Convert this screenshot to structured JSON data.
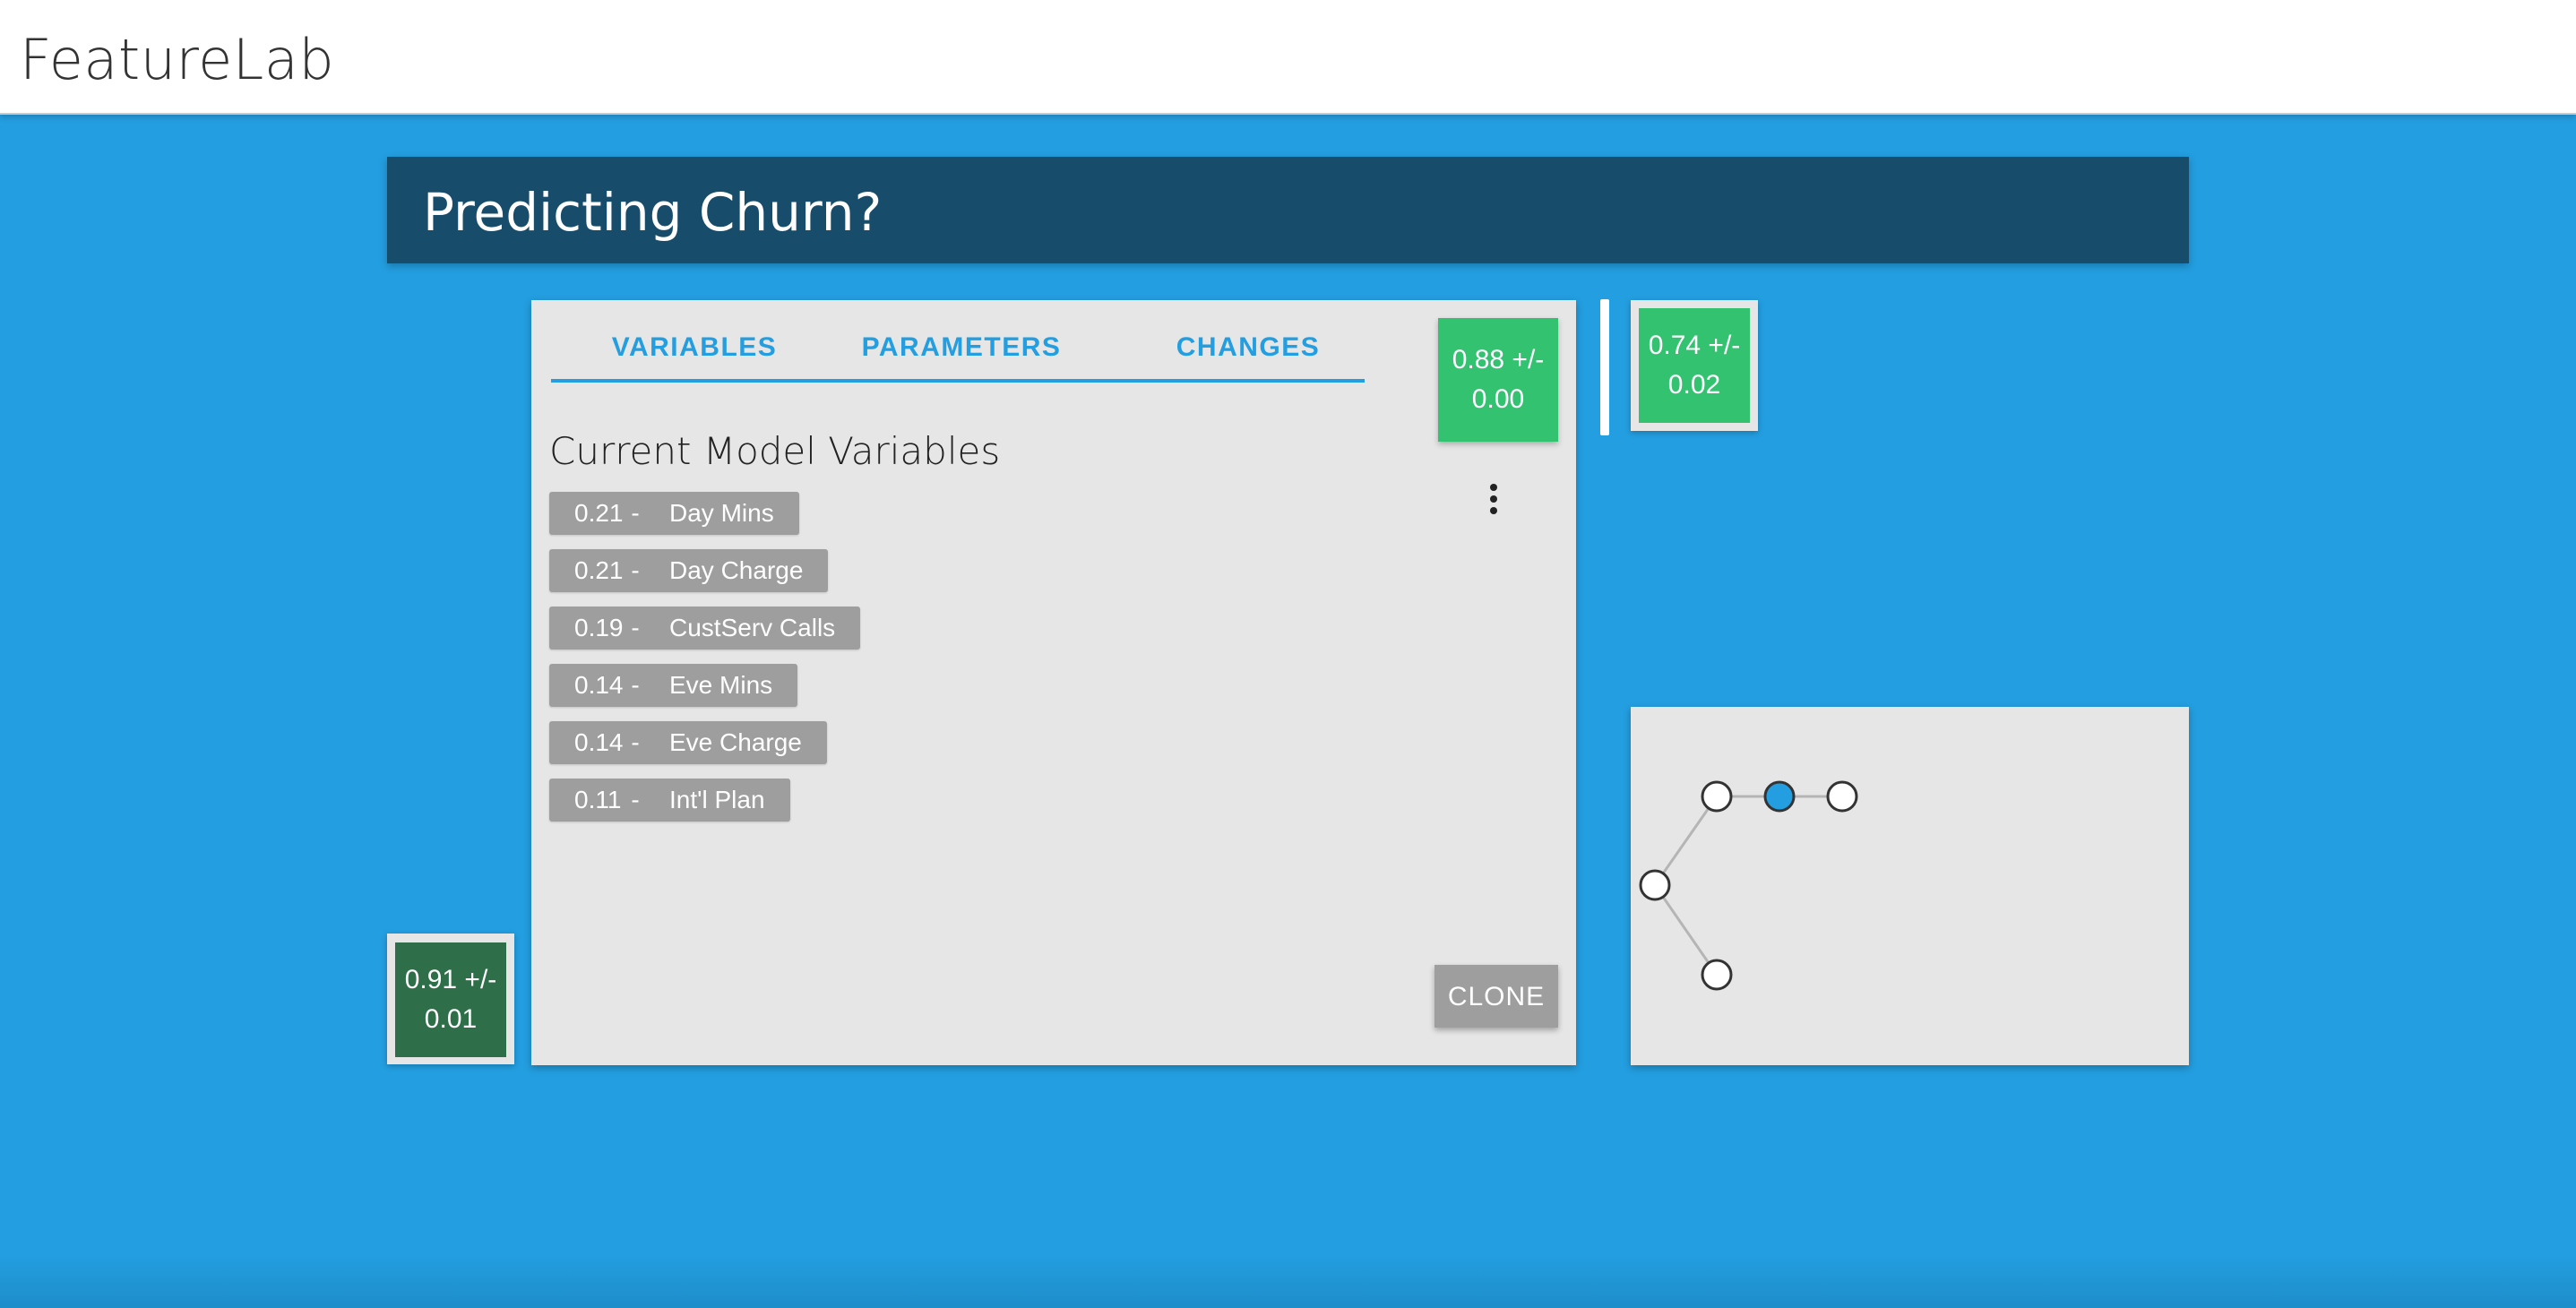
{
  "app": {
    "brand": "FeatureLab"
  },
  "header": {
    "title": "Predicting Churn?"
  },
  "tabs": [
    {
      "label": "VARIABLES",
      "active": true
    },
    {
      "label": "PARAMETERS",
      "active": false
    },
    {
      "label": "CHANGES",
      "active": false
    }
  ],
  "panel": {
    "section_title": "Current Model Variables",
    "variables": [
      {
        "value": "0.21",
        "sep": "-",
        "name": "Day Mins"
      },
      {
        "value": "0.21",
        "sep": "-",
        "name": "Day Charge"
      },
      {
        "value": "0.19",
        "sep": "-",
        "name": "CustServ Calls"
      },
      {
        "value": "0.14",
        "sep": "-",
        "name": "Eve Mins"
      },
      {
        "value": "0.14",
        "sep": "-",
        "name": "Eve Charge"
      },
      {
        "value": "0.11",
        "sep": "-",
        "name": "Int'l Plan"
      }
    ],
    "clone_label": "CLONE"
  },
  "scores": {
    "current": {
      "line1": "0.88 +/-",
      "line2": "0.00"
    },
    "next": {
      "line1": "0.74 +/-",
      "line2": "0.02"
    },
    "previous": {
      "line1": "0.91 +/-",
      "line2": "0.01"
    }
  },
  "colors": {
    "background": "#239ee0",
    "header": "#174c6a",
    "score_green": "#33c270",
    "score_dark_green": "#2e6e48",
    "chip_gray": "#9e9e9e",
    "node_selected": "#239ee0"
  },
  "tree": {
    "nodes": [
      {
        "id": "root",
        "selected": false
      },
      {
        "id": "a",
        "selected": false
      },
      {
        "id": "b",
        "selected": true
      },
      {
        "id": "c",
        "selected": false
      },
      {
        "id": "d",
        "selected": false
      }
    ],
    "edges": [
      [
        "root",
        "a"
      ],
      [
        "a",
        "b"
      ],
      [
        "b",
        "c"
      ],
      [
        "root",
        "d"
      ]
    ]
  }
}
